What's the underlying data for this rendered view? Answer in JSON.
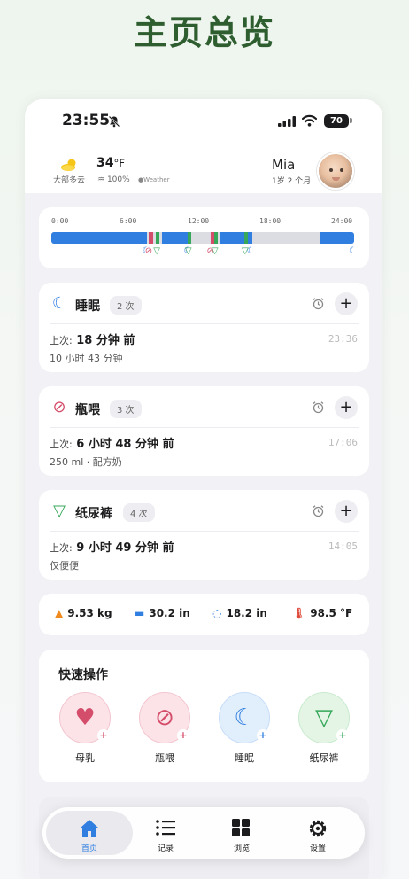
{
  "heading": "主页总览",
  "status": {
    "time": "23:55",
    "battery": "70"
  },
  "weather": {
    "temp_value": "34",
    "temp_unit": "°F",
    "condition": "大部多云",
    "humidity": "100%",
    "source": "Weather"
  },
  "baby": {
    "name": "Mia",
    "age": "1岁 2 个月"
  },
  "timeline": {
    "labels": [
      "0:00",
      "6:00",
      "12:00",
      "18:00",
      "24:00"
    ],
    "sleep_segments_hours": [
      [
        0,
        7.6
      ],
      [
        8.8,
        10.9
      ],
      [
        13.3,
        15.9
      ],
      [
        21.3,
        24
      ]
    ],
    "feed_marks_hours": [
      7.7,
      12.6
    ],
    "diaper_marks_hours": [
      8.3,
      10.8,
      12.9,
      15.3
    ]
  },
  "activities": [
    {
      "title": "睡眠",
      "count": "2 次",
      "last_prefix": "上次:",
      "last": "18 分钟 前",
      "time": "23:36",
      "sub": "10 小时 43 分钟"
    },
    {
      "title": "瓶喂",
      "count": "3 次",
      "last_prefix": "上次:",
      "last": "6 小时 48 分钟 前",
      "time": "17:06",
      "sub": "250 ml · 配方奶"
    },
    {
      "title": "纸尿裤",
      "count": "4 次",
      "last_prefix": "上次:",
      "last": "9 小时 49 分钟 前",
      "time": "14:05",
      "sub": "仅便便"
    }
  ],
  "metrics": {
    "weight": "9.53 kg",
    "height": "30.2 in",
    "head": "18.2 in",
    "temperature": "98.5 °F"
  },
  "quick_actions": {
    "title": "快速操作",
    "items": [
      "母乳",
      "瓶喂",
      "睡眠",
      "纸尿裤"
    ]
  },
  "tabs": [
    "首页",
    "记录",
    "浏览",
    "设置"
  ],
  "colors": {
    "sleep": "#2f7ee0",
    "feed": "#d44d6a",
    "diaper": "#37a85a",
    "heading": "#2e5e2f"
  }
}
